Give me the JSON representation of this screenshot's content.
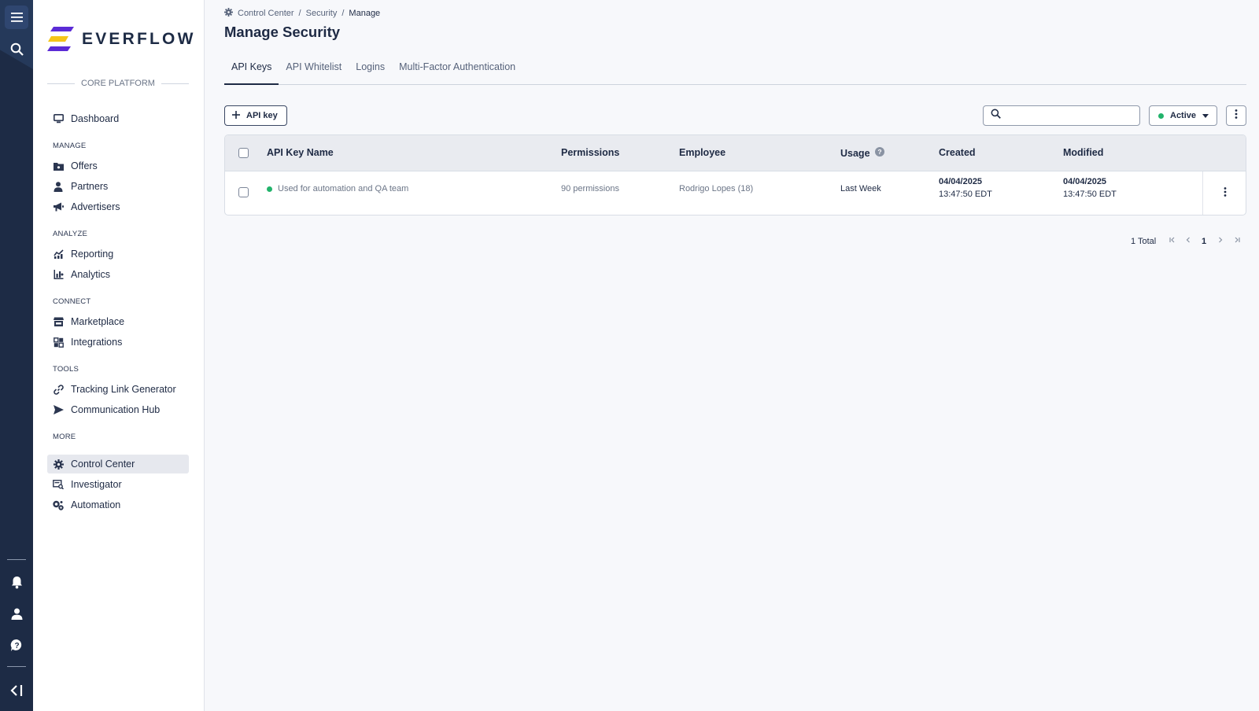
{
  "brand": {
    "name": "EVERFLOW",
    "platform": "CORE PLATFORM"
  },
  "sidebar": {
    "top": [
      {
        "label": "Dashboard",
        "icon": "monitor-icon"
      }
    ],
    "sections": [
      {
        "title": "MANAGE",
        "items": [
          {
            "label": "Offers",
            "icon": "offers-icon"
          },
          {
            "label": "Partners",
            "icon": "partners-icon"
          },
          {
            "label": "Advertisers",
            "icon": "megaphone-icon"
          }
        ]
      },
      {
        "title": "ANALYZE",
        "items": [
          {
            "label": "Reporting",
            "icon": "reporting-icon"
          },
          {
            "label": "Analytics",
            "icon": "analytics-icon"
          }
        ]
      },
      {
        "title": "CONNECT",
        "items": [
          {
            "label": "Marketplace",
            "icon": "store-icon"
          },
          {
            "label": "Integrations",
            "icon": "integrations-icon"
          }
        ]
      },
      {
        "title": "TOOLS",
        "items": [
          {
            "label": "Tracking Link Generator",
            "icon": "link-icon"
          },
          {
            "label": "Communication Hub",
            "icon": "send-icon"
          }
        ]
      },
      {
        "title": "MORE",
        "items": [
          {
            "label": "Control Center",
            "icon": "gear-icon",
            "active": true
          },
          {
            "label": "Investigator",
            "icon": "investigator-icon"
          },
          {
            "label": "Automation",
            "icon": "automation-icon"
          }
        ]
      }
    ]
  },
  "breadcrumb": {
    "items": [
      "Control Center",
      "Security",
      "Manage"
    ],
    "separator": "/"
  },
  "page": {
    "title": "Manage Security"
  },
  "tabs": [
    {
      "label": "API Keys",
      "active": true
    },
    {
      "label": "API Whitelist"
    },
    {
      "label": "Logins"
    },
    {
      "label": "Multi-Factor Authentication"
    }
  ],
  "toolbar": {
    "add_label": "API key",
    "search_placeholder": "",
    "status_value": "Active",
    "status_color": "#22b36b"
  },
  "table": {
    "columns": [
      "API Key Name",
      "Permissions",
      "Employee",
      "Usage",
      "Created",
      "Modified"
    ],
    "rows": [
      {
        "name": "Used for automation and QA team",
        "permissions": "90 permissions",
        "employee": "Rodrigo Lopes (18)",
        "usage": "Last Week",
        "created_date": "04/04/2025",
        "created_time": "13:47:50 EDT",
        "modified_date": "04/04/2025",
        "modified_time": "13:47:50 EDT"
      }
    ]
  },
  "pagination": {
    "total": "1 Total",
    "current": "1"
  },
  "colors": {
    "rail": "#1d2b45",
    "accent": "#1e2a44",
    "active_status": "#22b36b"
  }
}
